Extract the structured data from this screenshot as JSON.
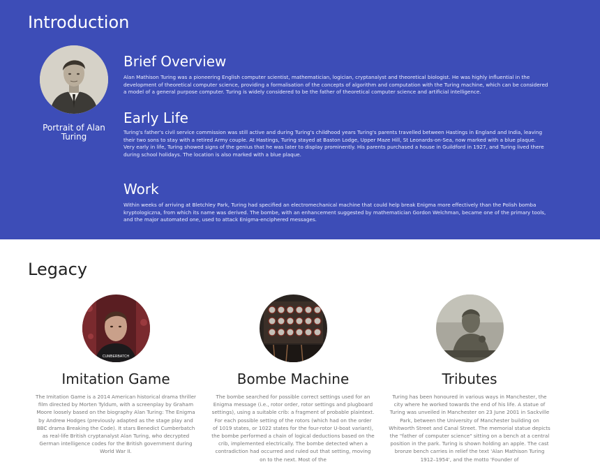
{
  "intro": {
    "title": "Introduction",
    "portrait_caption": "Portrait of Alan Turing",
    "sections": [
      {
        "title": "Brief Overview",
        "paragraphs": [
          "Alan Mathison Turing was a pioneering English computer scientist, mathematician, logician, cryptanalyst and theoretical biologist. He was highly influential in the development of theoretical computer science, providing a formalisation of the concepts of algorithm and computation with the Turing machine, which can be considered a model of a general purpose computer. Turing is widely considered to be the father of theoretical computer science and artificial intelligence."
        ]
      },
      {
        "title": "Early Life",
        "paragraphs": [
          "Turing's father's civil service commission was still active and during Turing's childhood years Turing's parents travelled between Hastings in England and India, leaving their two sons to stay with a retired Army couple. At Hastings, Turing stayed at Baston Lodge, Upper Maze Hill, St Leonards-on-Sea, now marked with a blue plaque.",
          "Very early in life, Turing showed signs of the genius that he was later to display prominently. His parents purchased a house in Guildford in 1927, and Turing lived there during school holidays. The location is also marked with a blue plaque."
        ]
      },
      {
        "title": "Work",
        "paragraphs": [
          "Within weeks of arriving at Bletchley Park, Turing had specified an electromechanical machine that could help break Enigma more effectively than the Polish bomba kryptologiczna, from which its name was derived. The bombe, with an enhancement suggested by mathematician Gordon Welchman, became one of the primary tools, and the major automated one, used to attack Enigma-enciphered messages."
        ]
      }
    ]
  },
  "legacy": {
    "title": "Legacy",
    "cards": [
      {
        "title": "Imitation Game",
        "image_label": "CUMBERBATCH",
        "body": "The Imitation Game is a 2014 American historical drama thriller film directed by Morten Tyldum, with a screenplay by Graham Moore loosely based on the biography Alan Turing: The Enigma by Andrew Hodges (previously adapted as the stage play and BBC drama Breaking the Code). It stars Benedict Cumberbatch as real-life British cryptanalyst Alan Turing, who decrypted German intelligence codes for the British government during World War II."
      },
      {
        "title": "Bombe Machine",
        "body": "The bombe searched for possible correct settings used for an Enigma message (i.e., rotor order, rotor settings and plugboard settings), using a suitable crib: a fragment of probable plaintext. For each possible setting of the rotors (which had on the order of 1019 states, or 1022 states for the four-rotor U-boat variant), the bombe performed a chain of logical deductions based on the crib, implemented electrically. The bombe detected when a contradiction had occurred and ruled out that setting, moving on to the next. Most of the"
      },
      {
        "title": "Tributes",
        "body": "Turing has been honoured in various ways in Manchester, the city where he worked towards the end of his life. A statue of Turing was unveiled in Manchester on 23 June 2001 in Sackville Park, between the University of Manchester building on Whitworth Street and Canal Street. The memorial statue depicts the \"father of computer science\" sitting on a bench at a central position in the park. Turing is shown holding an apple. The cast bronze bench carries in relief the text 'Alan Mathison Turing 1912–1954', and the motto 'Founder of"
      }
    ]
  },
  "colors": {
    "intro_bg": "#3d4db7",
    "heading_dark": "#222222",
    "body_grey": "#777777"
  }
}
